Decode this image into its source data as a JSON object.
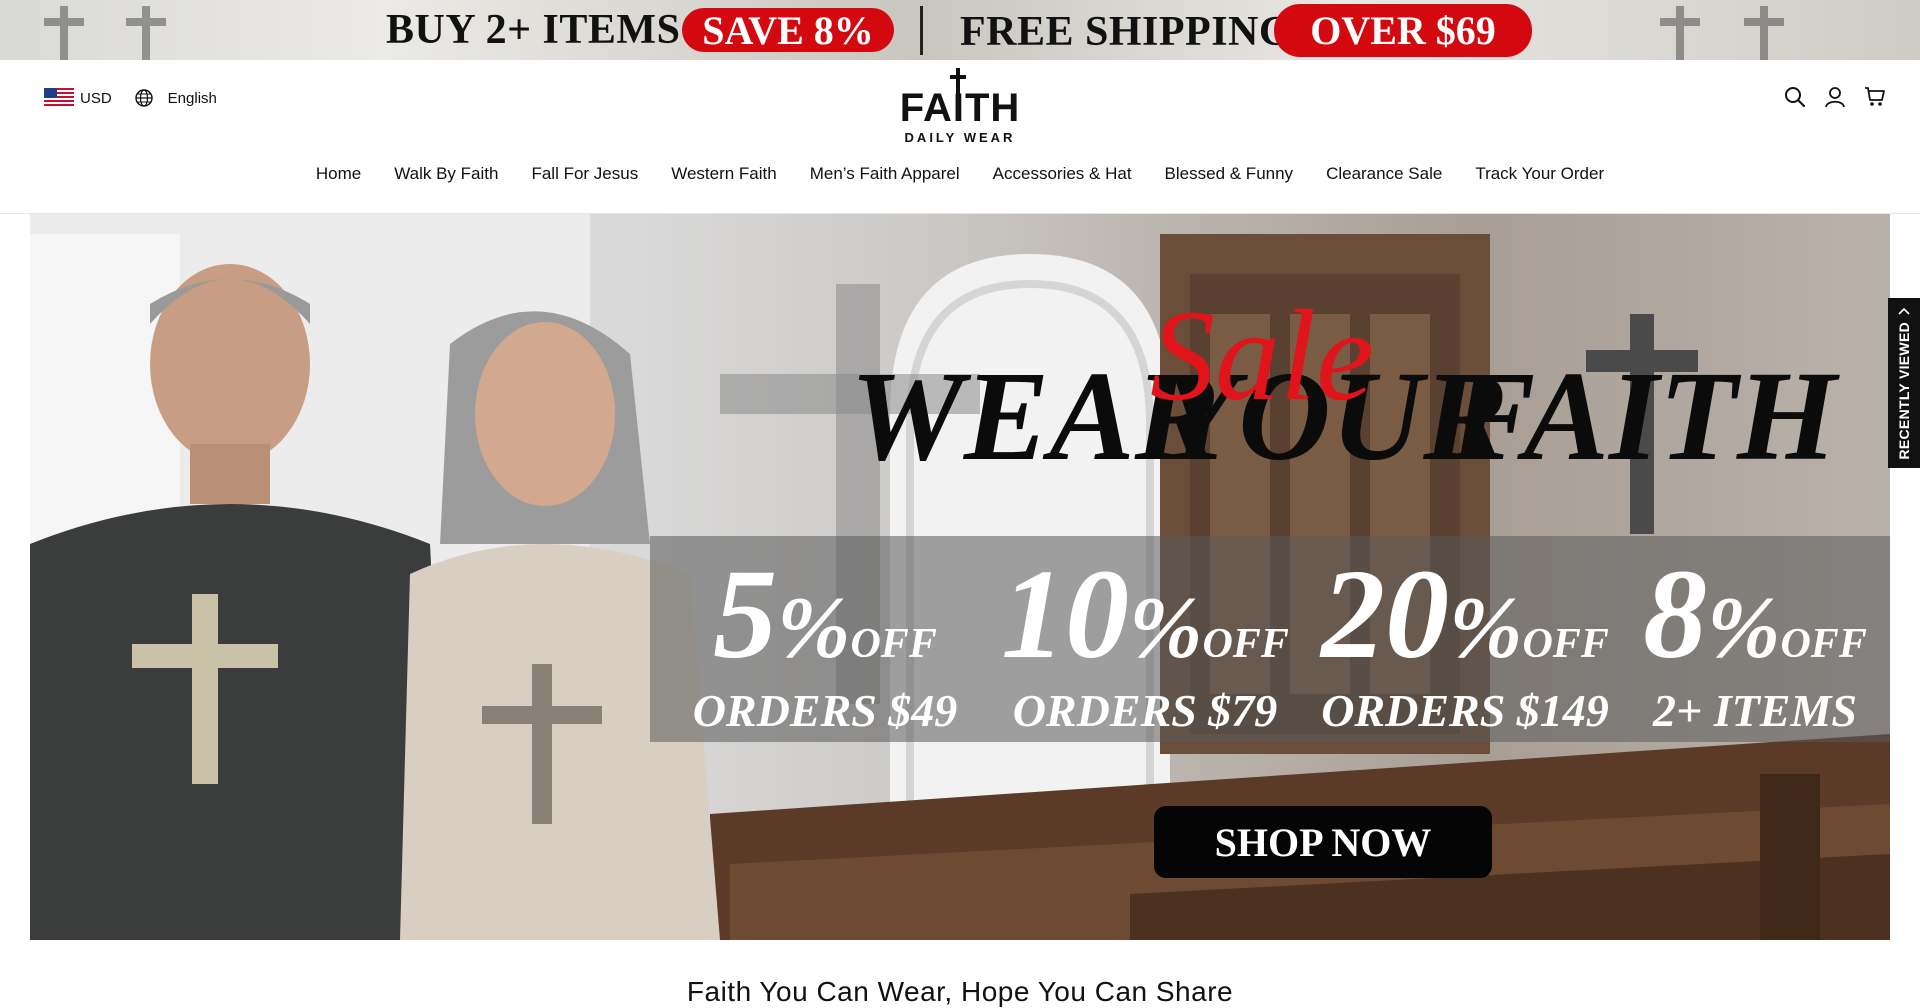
{
  "promo_bar": {
    "left_text": "BUY 2+  ITEMS",
    "left_badge": "SAVE 8%",
    "right_text": "FREE SHIPPING",
    "right_badge": "OVER $69",
    "badge_color": "#d4090f"
  },
  "header": {
    "currency": "USD",
    "language": "English",
    "logo_word": "FAITH",
    "logo_sub": "DAILY WEAR",
    "icons": [
      "search-icon",
      "account-icon",
      "cart-icon"
    ]
  },
  "nav": {
    "items": [
      "Home",
      "Walk By Faith",
      "Fall For Jesus",
      "Western Faith",
      "Men’s Faith Apparel",
      "Accessories & Hat",
      "Blessed & Funny",
      "Clearance Sale",
      "Track Your Order"
    ]
  },
  "hero": {
    "headline_left": "WEAR",
    "headline_mid": "YOUR",
    "headline_right": "FAITH",
    "headline_overlay": "Sale",
    "overlay_color": "#e0141b",
    "offers": [
      {
        "value": "5",
        "unit": "%",
        "suffix": "OFF",
        "condition": "ORDERS $49"
      },
      {
        "value": "10",
        "unit": "%",
        "suffix": "OFF",
        "condition": "ORDERS $79"
      },
      {
        "value": "20",
        "unit": "%",
        "suffix": "OFF",
        "condition": "ORDERS $149"
      },
      {
        "value": "8",
        "unit": "%",
        "suffix": "OFF",
        "condition": "2+ ITEMS"
      }
    ],
    "cta": "SHOP NOW"
  },
  "recently_viewed": {
    "label": "RECENTLY VIEWED"
  },
  "tagline": "Faith You Can Wear, Hope You Can Share"
}
